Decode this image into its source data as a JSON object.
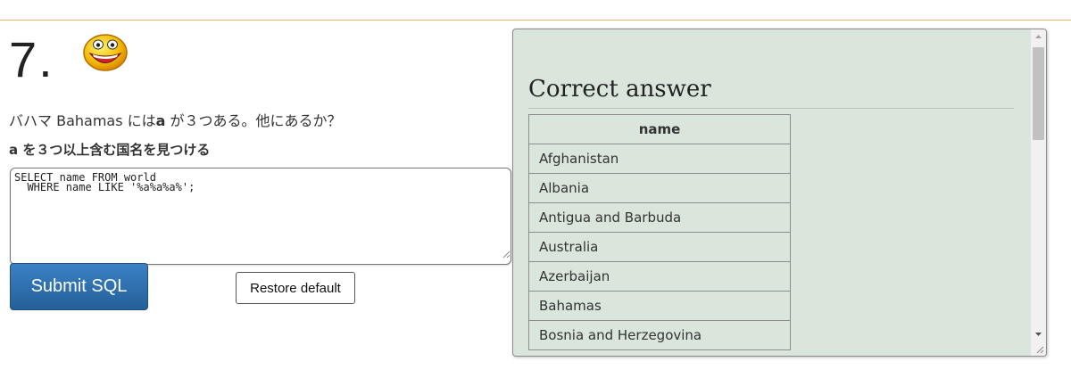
{
  "question": {
    "number": "7.",
    "smiley_icon": "laughing-face",
    "text_prefix": "バハマ Bahamas には",
    "text_bold": "a",
    "text_suffix": " が３つある。他にあるか？",
    "task": "a を３つ以上含む国名を見つける"
  },
  "editor": {
    "sql": "SELECT name FROM world\n  WHERE name LIKE '%a%a%a%';"
  },
  "buttons": {
    "submit_label": "Submit SQL",
    "restore_label": "Restore default"
  },
  "answer": {
    "title": "Correct answer",
    "column_header": "name",
    "rows": [
      "Afghanistan",
      "Albania",
      "Antigua and Barbuda",
      "Australia",
      "Azerbaijan",
      "Bahamas",
      "Bosnia and Herzegovina"
    ]
  },
  "colors": {
    "accent_rule": "#e8b75e",
    "submit_bg": "#2d6fad",
    "answer_bg": "#dae5dc"
  }
}
